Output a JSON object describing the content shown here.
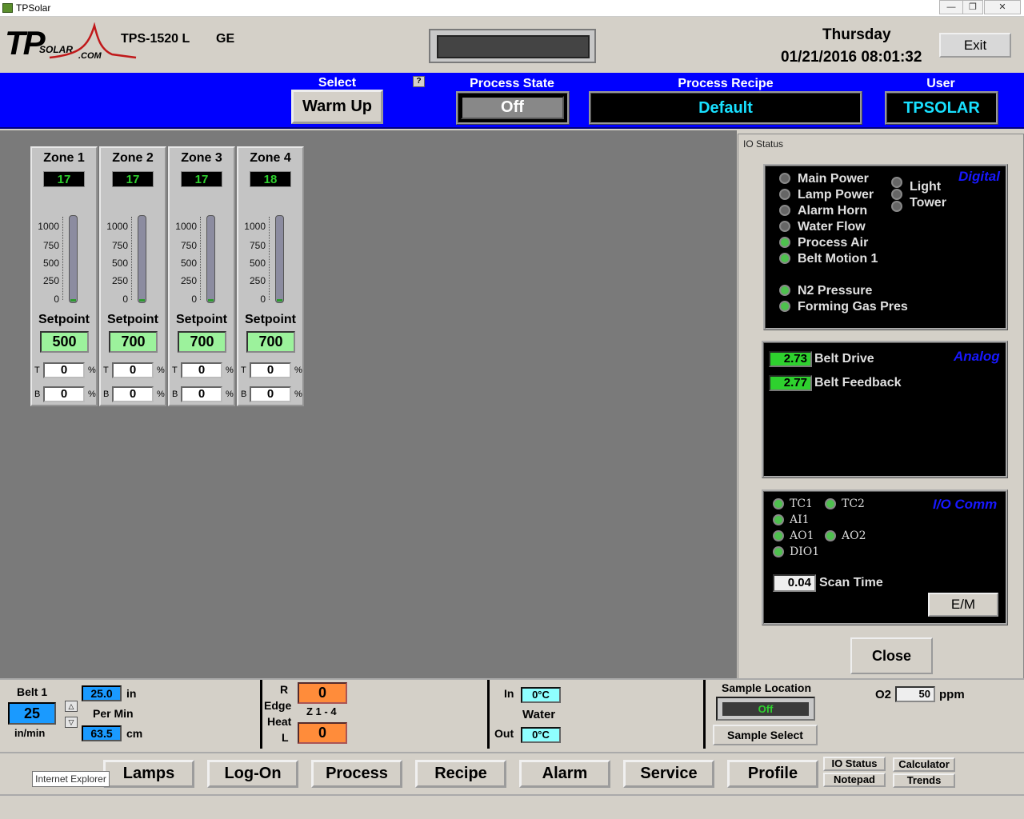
{
  "window": {
    "title": "TPSolar"
  },
  "header": {
    "logo": {
      "main": "TP",
      "sub": "SOLAR",
      "com": ".COM"
    },
    "model": "TPS-1520 L",
    "code": "GE",
    "day": "Thursday",
    "datetime": "01/21/2016 08:01:32",
    "exit_label": "Exit"
  },
  "bluebar": {
    "select_label": "Select",
    "select_value": "Warm Up",
    "help_label": "?",
    "state_label": "Process State",
    "state_value": "Off",
    "recipe_label": "Process Recipe",
    "recipe_value": "Default",
    "user_label": "User",
    "user_value": "TPSOLAR"
  },
  "zones": [
    {
      "name": "Zone 1",
      "temp": "17",
      "setpoint_label": "Setpoint",
      "setpoint": "500",
      "top": "0",
      "bottom": "0"
    },
    {
      "name": "Zone 2",
      "temp": "17",
      "setpoint_label": "Setpoint",
      "setpoint": "700",
      "top": "0",
      "bottom": "0"
    },
    {
      "name": "Zone 3",
      "temp": "17",
      "setpoint_label": "Setpoint",
      "setpoint": "700",
      "top": "0",
      "bottom": "0"
    },
    {
      "name": "Zone 4",
      "temp": "18",
      "setpoint_label": "Setpoint",
      "setpoint": "700",
      "top": "0",
      "bottom": "0"
    }
  ],
  "zone_scale": [
    "1000",
    "750",
    "500",
    "250",
    "0"
  ],
  "zone_tb": {
    "t": "T",
    "b": "B",
    "pct": "%"
  },
  "io": {
    "header": "IO Status",
    "digital_title": "Digital",
    "digital": [
      {
        "label": "Main Power",
        "state": "off"
      },
      {
        "label": "Lamp Power",
        "state": "off"
      },
      {
        "label": "Alarm Horn",
        "state": "off"
      },
      {
        "label": "Water Flow",
        "state": "off"
      },
      {
        "label": "Process Air",
        "state": "on"
      },
      {
        "label": "Belt Motion 1",
        "state": "on"
      },
      {
        "label": "N2 Pressure",
        "state": "on"
      },
      {
        "label": "Forming Gas Pres",
        "state": "on"
      }
    ],
    "light_tower": {
      "line1": "Light",
      "line2": "Tower"
    },
    "analog_title": "Analog",
    "analog": [
      {
        "value": "2.73",
        "label": "Belt Drive"
      },
      {
        "value": "2.77",
        "label": "Belt Feedback"
      }
    ],
    "comm_title": "I/O Comm",
    "comm": [
      {
        "label": "TC1",
        "state": "on"
      },
      {
        "label": "TC2",
        "state": "on"
      },
      {
        "label": "AI1",
        "state": "on"
      },
      {
        "label": "AO1",
        "state": "on"
      },
      {
        "label": "AO2",
        "state": "on"
      },
      {
        "label": "DIO1",
        "state": "on"
      }
    ],
    "scan_value": "0.04",
    "scan_label": "Scan Time",
    "em_label": "E/M",
    "close_label": "Close"
  },
  "belt": {
    "label": "Belt 1",
    "value": "25",
    "unit": "in/min",
    "in_value": "25.0",
    "in_unit": "in",
    "per_min": "Per Min",
    "cm_value": "63.5",
    "cm_unit": "cm",
    "up": "△",
    "down": "▽"
  },
  "edge": {
    "r": "R",
    "edge": "Edge",
    "heat": "Heat",
    "l": "L",
    "range": "Z 1 - 4",
    "top_value": "0",
    "bottom_value": "0"
  },
  "water": {
    "in_label": "In",
    "in_value": "0°C",
    "label": "Water",
    "out_label": "Out",
    "out_value": "0°C"
  },
  "sample": {
    "location_label": "Sample Location",
    "state": "Off",
    "select_label": "Sample Select",
    "o2_label": "O2",
    "o2_value": "50",
    "o2_unit": "ppm"
  },
  "nav": {
    "buttons": [
      "Lamps",
      "Log-On",
      "Process",
      "Recipe",
      "Alarm",
      "Service",
      "Profile"
    ],
    "io_status": "IO Status",
    "notepad": "Notepad",
    "calculator": "Calculator",
    "trends": "Trends",
    "tooltip": "Internet Explorer"
  }
}
